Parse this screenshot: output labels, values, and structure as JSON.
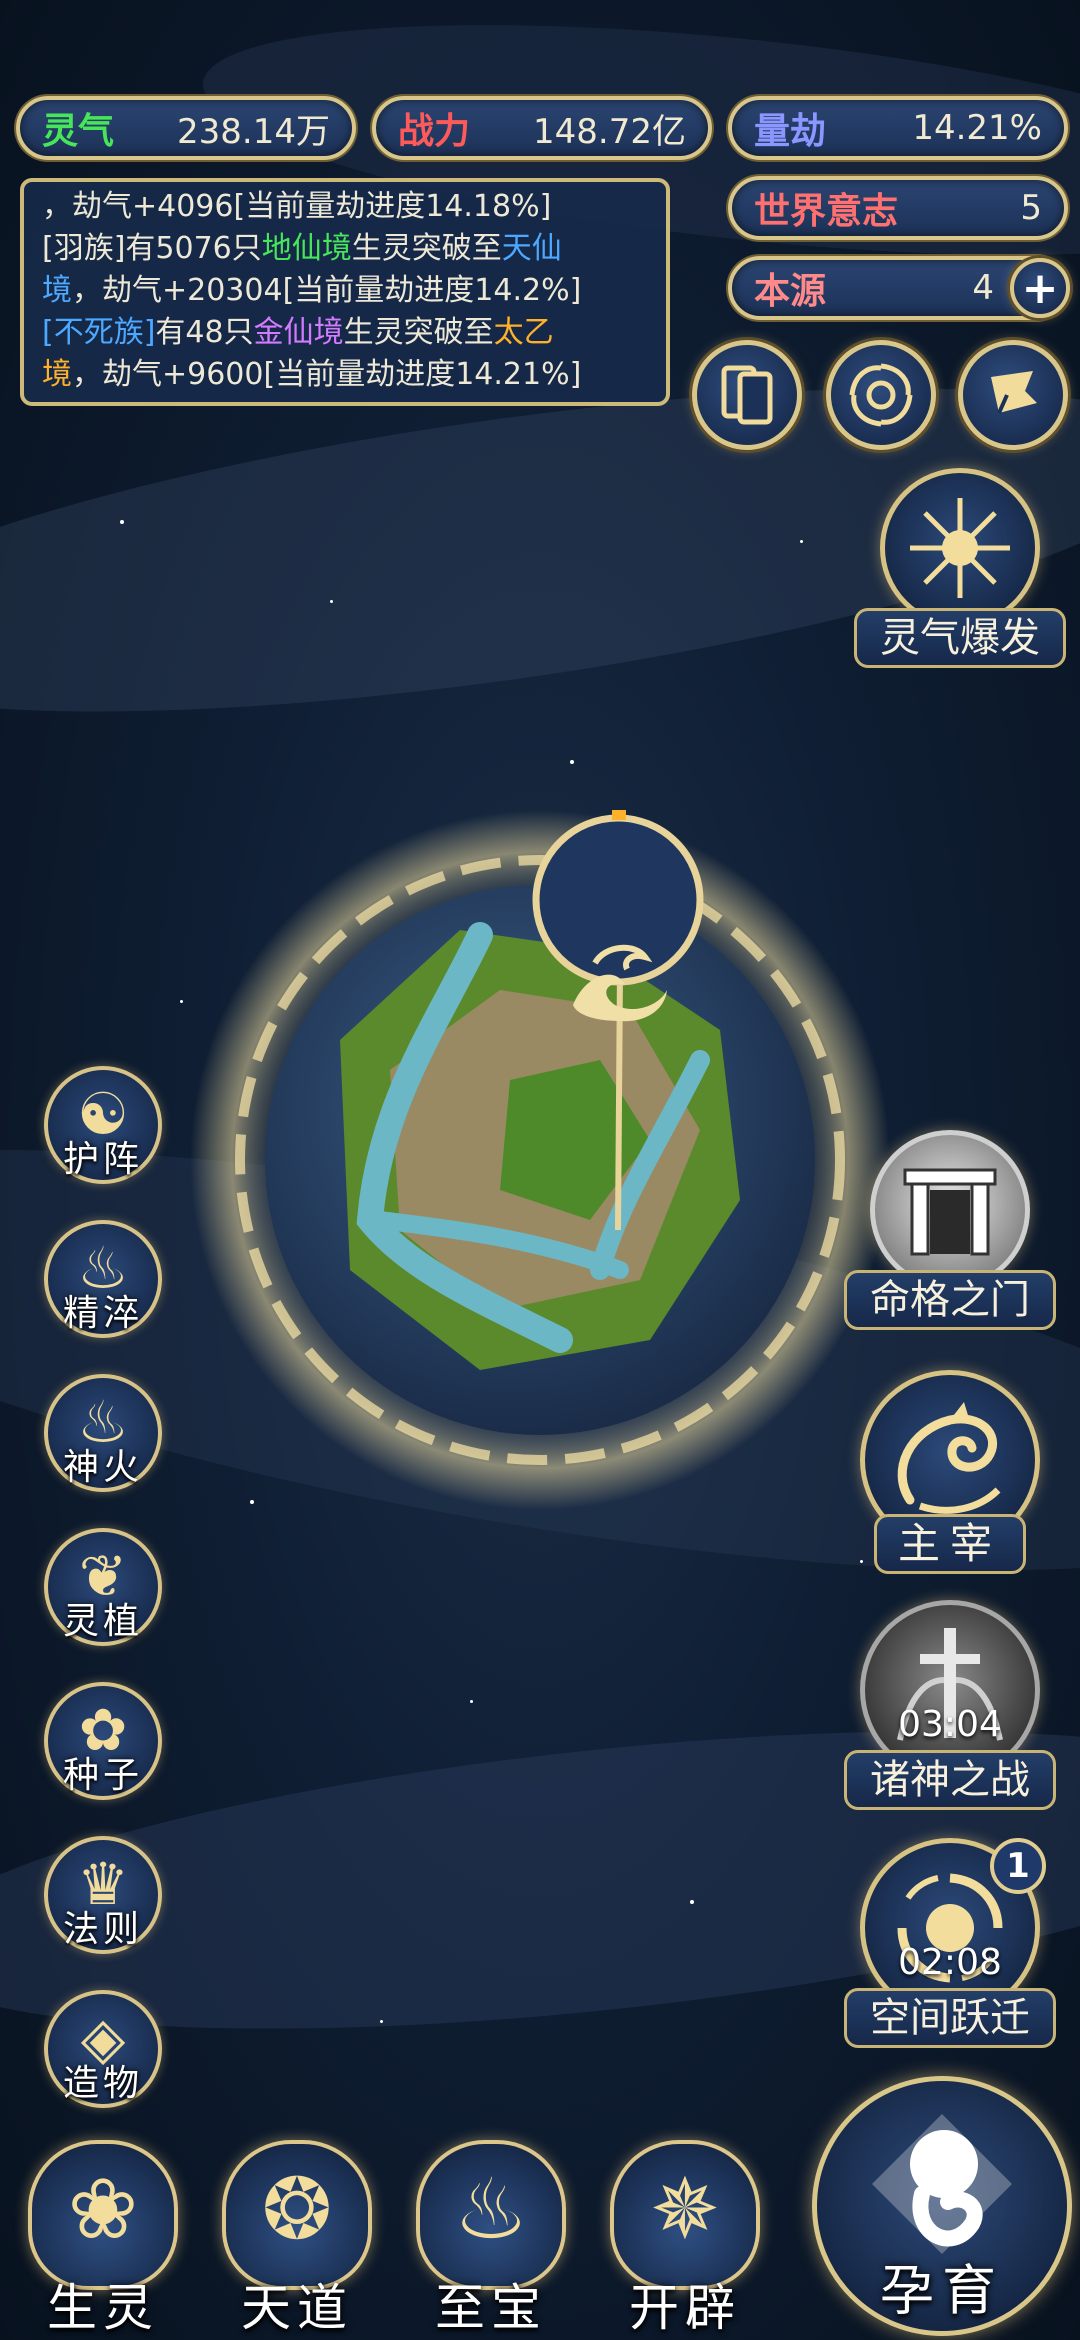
{
  "resources": {
    "spirit_qi": {
      "label": "灵气",
      "value": "238.14万",
      "color": "#47e65a"
    },
    "combat_power": {
      "label": "战力",
      "value": "148.72亿",
      "color": "#ff5a5a"
    },
    "calamity": {
      "label": "量劫",
      "value": "14.21%",
      "color": "#7a8bff"
    },
    "world_will": {
      "label": "世界意志",
      "value": "5",
      "color": "#ff6b6b"
    },
    "origin": {
      "label": "本源",
      "value": "4",
      "color": "#ff8a8a"
    }
  },
  "log": {
    "line1": "，劫气+4096[当前量劫进度14.18%]",
    "entry2": {
      "prefix": "[羽族]有5076只",
      "realm_from": "地仙境",
      "middle": "生灵突破至",
      "realm_to": "天仙",
      "realm_to_cont": "境",
      "suffix": "，劫气+20304[当前量劫进度14.2%]"
    },
    "entry3": {
      "race": "[不死族]",
      "prefix": "有48只",
      "realm_from": "金仙境",
      "middle": "生灵突破至",
      "realm_to": "太乙",
      "realm_to_cont": "境",
      "suffix": "，劫气+9600[当前量劫进度14.21%]"
    }
  },
  "top_icons": {
    "cards": "cards-icon",
    "vortex": "vortex-icon",
    "flag": "flag-icon",
    "plus": "+"
  },
  "right_menu": {
    "spirit_burst": "灵气爆发",
    "destiny_gate": "命格之门",
    "sovereign": "主宰",
    "gods_war": "诸神之战",
    "gods_war_timer": "03:04",
    "space_jump": "空间跃迁",
    "space_jump_timer": "02:08",
    "space_jump_badge": "1"
  },
  "left_menu": [
    {
      "label": "护阵",
      "glyph": "☯"
    },
    {
      "label": "精淬",
      "glyph": "♨"
    },
    {
      "label": "神火",
      "glyph": "♨"
    },
    {
      "label": "灵植",
      "glyph": "❦"
    },
    {
      "label": "种子",
      "glyph": "✿"
    },
    {
      "label": "法则",
      "glyph": "♛"
    },
    {
      "label": "造物",
      "glyph": "◈"
    }
  ],
  "bottom_tabs": [
    {
      "label": "生灵",
      "glyph": "❀"
    },
    {
      "label": "天道",
      "glyph": "❂"
    },
    {
      "label": "至宝",
      "glyph": "♨"
    },
    {
      "label": "开辟",
      "glyph": "✵"
    }
  ],
  "incubate": {
    "label": "孕育"
  },
  "world_marker": "wave-icon"
}
